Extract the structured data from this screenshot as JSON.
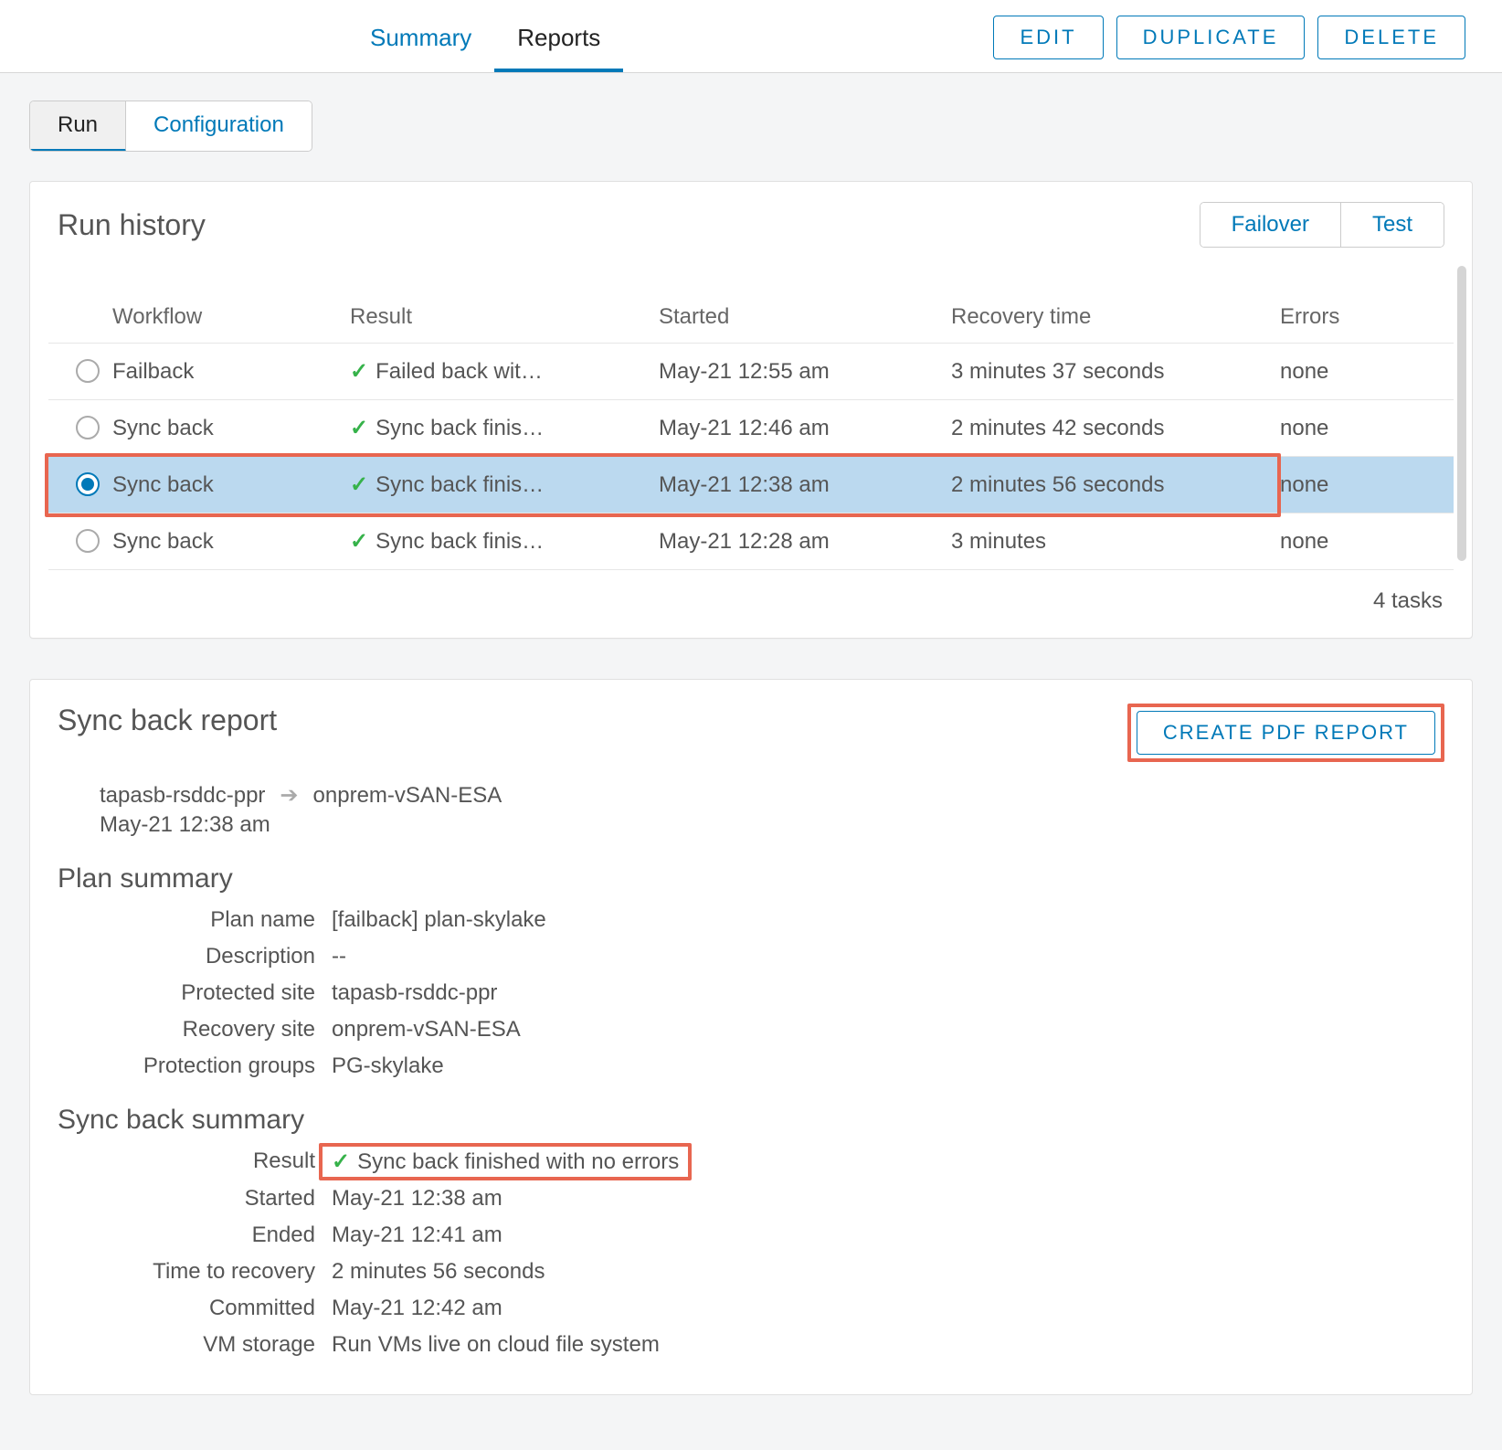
{
  "topbar": {
    "tabs": {
      "summary": "Summary",
      "reports": "Reports"
    },
    "buttons": {
      "edit": "EDIT",
      "duplicate": "DUPLICATE",
      "delete": "DELETE"
    }
  },
  "subtabs": {
    "run": "Run",
    "configuration": "Configuration"
  },
  "runHistory": {
    "title": "Run history",
    "segments": {
      "failover": "Failover",
      "test": "Test"
    },
    "headers": {
      "workflow": "Workflow",
      "result": "Result",
      "started": "Started",
      "recovery": "Recovery time",
      "errors": "Errors"
    },
    "rows": [
      {
        "workflow": "Failback",
        "result": "Failed back wit…",
        "started": "May-21 12:55 am",
        "recovery": "3 minutes 37 seconds",
        "errors": "none",
        "selected": false
      },
      {
        "workflow": "Sync back",
        "result": "Sync back finis…",
        "started": "May-21 12:46 am",
        "recovery": "2 minutes 42 seconds",
        "errors": "none",
        "selected": false
      },
      {
        "workflow": "Sync back",
        "result": "Sync back finis…",
        "started": "May-21 12:38 am",
        "recovery": "2 minutes 56 seconds",
        "errors": "none",
        "selected": true
      },
      {
        "workflow": "Sync back",
        "result": "Sync back finis…",
        "started": "May-21 12:28 am",
        "recovery": "3 minutes",
        "errors": "none",
        "selected": false
      }
    ],
    "footer": "4 tasks"
  },
  "report": {
    "title": "Sync back report",
    "pdfButton": "CREATE PDF REPORT",
    "source": "tapasb-rsddc-ppr",
    "dest": "onprem-vSAN-ESA",
    "timestamp": "May-21 12:38 am",
    "planSummaryTitle": "Plan summary",
    "plan": {
      "planNameLabel": "Plan name",
      "planName": "[failback] plan-skylake",
      "descriptionLabel": "Description",
      "description": "--",
      "protectedSiteLabel": "Protected site",
      "protectedSite": "tapasb-rsddc-ppr",
      "recoverySiteLabel": "Recovery site",
      "recoverySite": "onprem-vSAN-ESA",
      "protectionGroupsLabel": "Protection groups",
      "protectionGroups": "PG-skylake"
    },
    "syncSummaryTitle": "Sync back summary",
    "sync": {
      "resultLabel": "Result",
      "result": "Sync back finished with no errors",
      "startedLabel": "Started",
      "started": "May-21 12:38 am",
      "endedLabel": "Ended",
      "ended": "May-21 12:41 am",
      "ttrLabel": "Time to recovery",
      "ttr": "2 minutes 56 seconds",
      "committedLabel": "Committed",
      "committed": "May-21 12:42 am",
      "vmStorageLabel": "VM storage",
      "vmStorage": "Run VMs live on cloud file system"
    }
  }
}
